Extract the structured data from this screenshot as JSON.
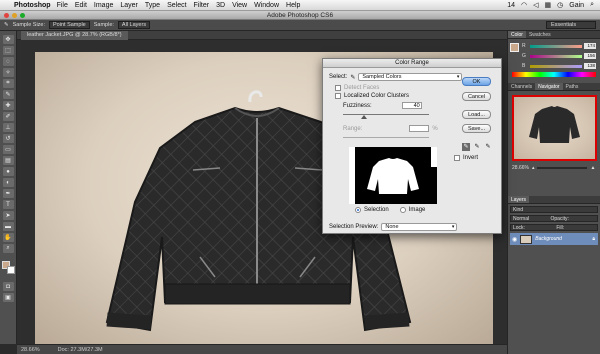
{
  "menubar": {
    "app": "Photoshop",
    "items": [
      "File",
      "Edit",
      "Image",
      "Layer",
      "Type",
      "Select",
      "Filter",
      "3D",
      "View",
      "Window",
      "Help"
    ],
    "battery": "14",
    "user": "Gain"
  },
  "window": {
    "title": "Adobe Photoshop CS6"
  },
  "options": {
    "sample_size_label": "Sample Size:",
    "sample_size_value": "Point Sample",
    "sample_label": "Sample:",
    "sample_value": "All Layers",
    "workspace": "Essentials"
  },
  "document": {
    "tab": "leather Jacket.JPG @ 28.7% (RGB/8*)",
    "zoom": "28.66%",
    "doc_size": "Doc: 27.3M/27.3M"
  },
  "panels": {
    "color_tabs": [
      "Color",
      "Swatches"
    ],
    "channels": [
      {
        "label": "R",
        "value": "174"
      },
      {
        "label": "G",
        "value": "156"
      },
      {
        "label": "B",
        "value": "138"
      }
    ],
    "nav_tabs": [
      "Channels",
      "Navigator",
      "Paths"
    ],
    "nav_zoom": "28.66%",
    "layers_tab": "Layers",
    "kind_label": "Kind",
    "blend_mode": "Normal",
    "opacity_label": "Opacity:",
    "lock_label": "Lock:",
    "fill_label": "Fill:",
    "layer_name": "Background"
  },
  "dialog": {
    "title": "Color Range",
    "select_label": "Select:",
    "select_value": "Sampled Colors",
    "detect_faces": "Detect Faces",
    "localized": "Localized Color Clusters",
    "fuzziness_label": "Fuzziness:",
    "fuzziness_value": "40",
    "range_label": "Range:",
    "range_unit": "%",
    "ok": "OK",
    "cancel": "Cancel",
    "load": "Load...",
    "save": "Save...",
    "invert": "Invert",
    "radio_selection": "Selection",
    "radio_image": "Image",
    "preview_label": "Selection Preview:",
    "preview_value": "None"
  }
}
